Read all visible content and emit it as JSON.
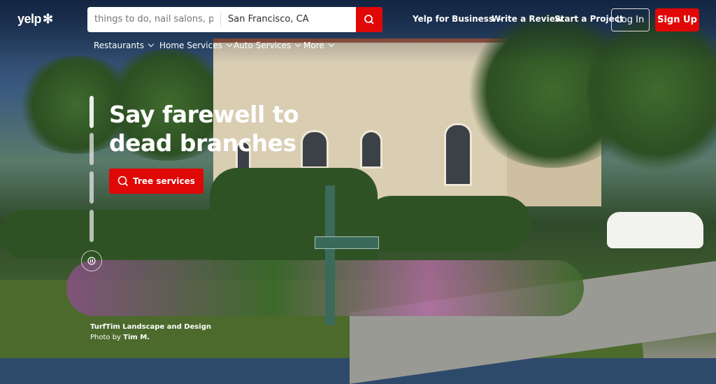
{
  "header": {
    "logo": "yelp",
    "search": {
      "query_placeholder": "things to do, nail salons, plumbers",
      "location_value": "San Francisco, CA",
      "search_icon": "search-icon"
    },
    "categories": [
      {
        "label": "Restaurants"
      },
      {
        "label": "Home Services"
      },
      {
        "label": "Auto Services"
      },
      {
        "label": "More"
      }
    ],
    "links": {
      "business": "Yelp for Business",
      "review": "Write a Review",
      "project": "Start a Project"
    },
    "login": "Log In",
    "signup": "Sign Up"
  },
  "hero": {
    "headline_line1": "Say farewell to",
    "headline_line2": "dead branches",
    "cta_label": "Tree services",
    "slides": 4,
    "credit_business": "TurfTim Landscape and Design",
    "credit_prefix": "Photo by",
    "credit_author": "Tim M."
  },
  "colors": {
    "brand_red": "#e00707"
  }
}
